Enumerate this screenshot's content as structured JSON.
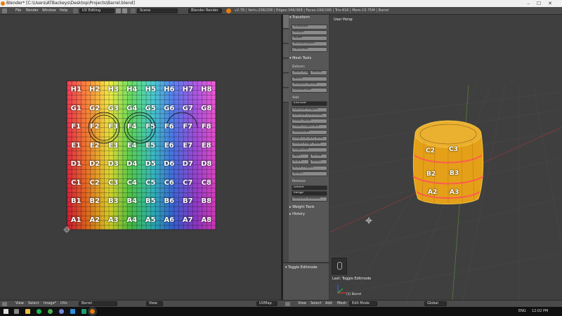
{
  "window": {
    "title": "Blender* [C:\\Users\\ATBackeys\\Desktop\\Projects\\Barrel.blend]"
  },
  "info": {
    "menus": [
      "File",
      "Render",
      "Window",
      "Help"
    ],
    "layout": "UV Editing",
    "scene": "Scene",
    "engine": "Blender Render",
    "stats": "v2.78 | Verts:208/208 | Edges:346/368 | Faces:166/166 | Tris:416 | Mem:15.75M | Barrel"
  },
  "tools": {
    "tabs": [
      "Tools",
      "Create",
      "Relations",
      "Shading / UVs",
      "Options",
      "Grease Pencil"
    ],
    "transform_header": "Transform",
    "transform": [
      "Translate",
      "Rotate",
      "Scale",
      "Shrink/Fatten",
      "Push/Pull"
    ],
    "mesh_tools_header": "Mesh Tools",
    "deform_label": "Deform:",
    "slide_edge": "Slide Edge",
    "vertex": "Vertex",
    "deform": [
      "Noise",
      "Smooth Vertex",
      "Randomize"
    ],
    "add_label": "Add:",
    "extrude": "Extrude",
    "add": [
      "Extrude Region",
      "Extrude Individual",
      "Inset Faces",
      "Make Edge/Face",
      "Subdivide",
      "Loop Cut and Slide",
      "Offset Edge Slide",
      "Duplicate"
    ],
    "spin": "Spin",
    "screw": "Screw",
    "knife": "Knife",
    "select": "Select",
    "add2": [
      "Knife Project",
      "Bisect"
    ],
    "remove_label": "Remove:",
    "delete": "Delete",
    "merge": "Merge",
    "remove_doubles": "Remove Doubles",
    "weight_tools": "Weight Tools",
    "history": "History",
    "operator": "Toggle Editmode"
  },
  "viewport": {
    "label": "User Persp",
    "last_op": "Last: Toggle Editmode",
    "object": "(1) Barrel",
    "barrel_labels": [
      "C2",
      "C3",
      "B2",
      "B3",
      "A2",
      "A3"
    ]
  },
  "uv": {
    "rows": [
      [
        "H1",
        "H2",
        "H3",
        "H4",
        "H5",
        "H6",
        "H7",
        "H8"
      ],
      [
        "G1",
        "G2",
        "G3",
        "G4",
        "G5",
        "G6",
        "G7",
        "G8"
      ],
      [
        "F1",
        "F2",
        "F3",
        "F4",
        "F5",
        "F6",
        "F7",
        "F8"
      ],
      [
        "E1",
        "E2",
        "E3",
        "E4",
        "E5",
        "E6",
        "E7",
        "E8"
      ],
      [
        "D1",
        "D2",
        "D3",
        "D4",
        "D5",
        "D6",
        "D7",
        "D8"
      ],
      [
        "C1",
        "C2",
        "C3",
        "C4",
        "C5",
        "C6",
        "C7",
        "C8"
      ],
      [
        "B1",
        "B2",
        "B3",
        "B4",
        "B5",
        "B6",
        "B7",
        "B8"
      ],
      [
        "A1",
        "A2",
        "A3",
        "A4",
        "A5",
        "A6",
        "A7",
        "A8"
      ]
    ]
  },
  "bottom": {
    "left_menus": [
      "View",
      "Select",
      "Image*",
      "UVs"
    ],
    "image": "Barrel",
    "view_menu": "View",
    "uvmap": "UVMap",
    "right_menus": [
      "View",
      "Select",
      "Add",
      "Mesh"
    ],
    "mode": "Edit Mode",
    "orientation": "Global"
  },
  "taskbar": {
    "lang": "ENG",
    "time": "12:02 PM"
  }
}
